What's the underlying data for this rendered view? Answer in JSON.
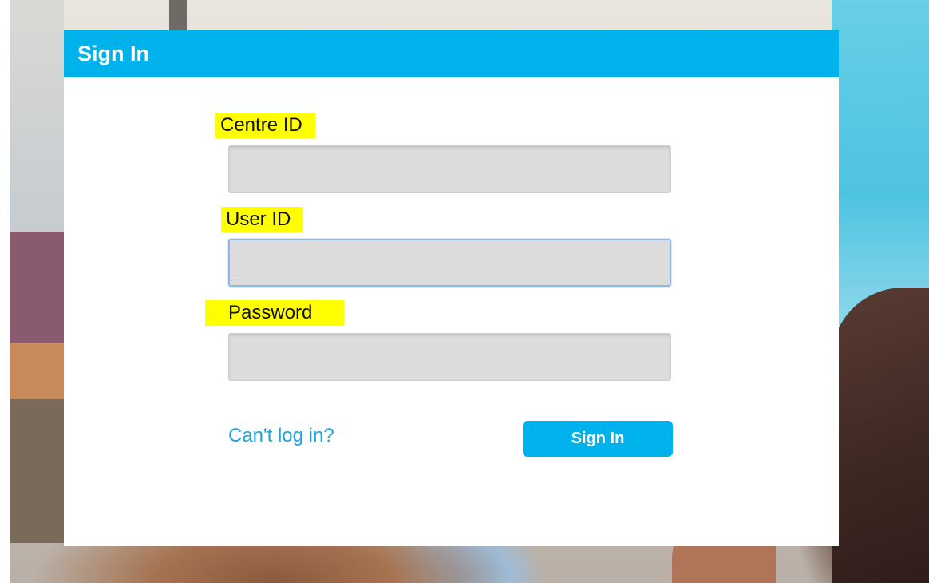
{
  "dialog": {
    "title": "Sign In"
  },
  "form": {
    "centre_id": {
      "label": "Centre ID",
      "value": "",
      "placeholder": ""
    },
    "user_id": {
      "label": "User ID",
      "value": "",
      "placeholder": ""
    },
    "password": {
      "label": "Password",
      "value": "",
      "placeholder": ""
    }
  },
  "actions": {
    "cant_login": "Can't log in?",
    "sign_in": "Sign In"
  },
  "colors": {
    "header": "#00b2ec",
    "highlight": "#ffff00",
    "link": "#1aa3dc",
    "button": "#00b2ec"
  }
}
